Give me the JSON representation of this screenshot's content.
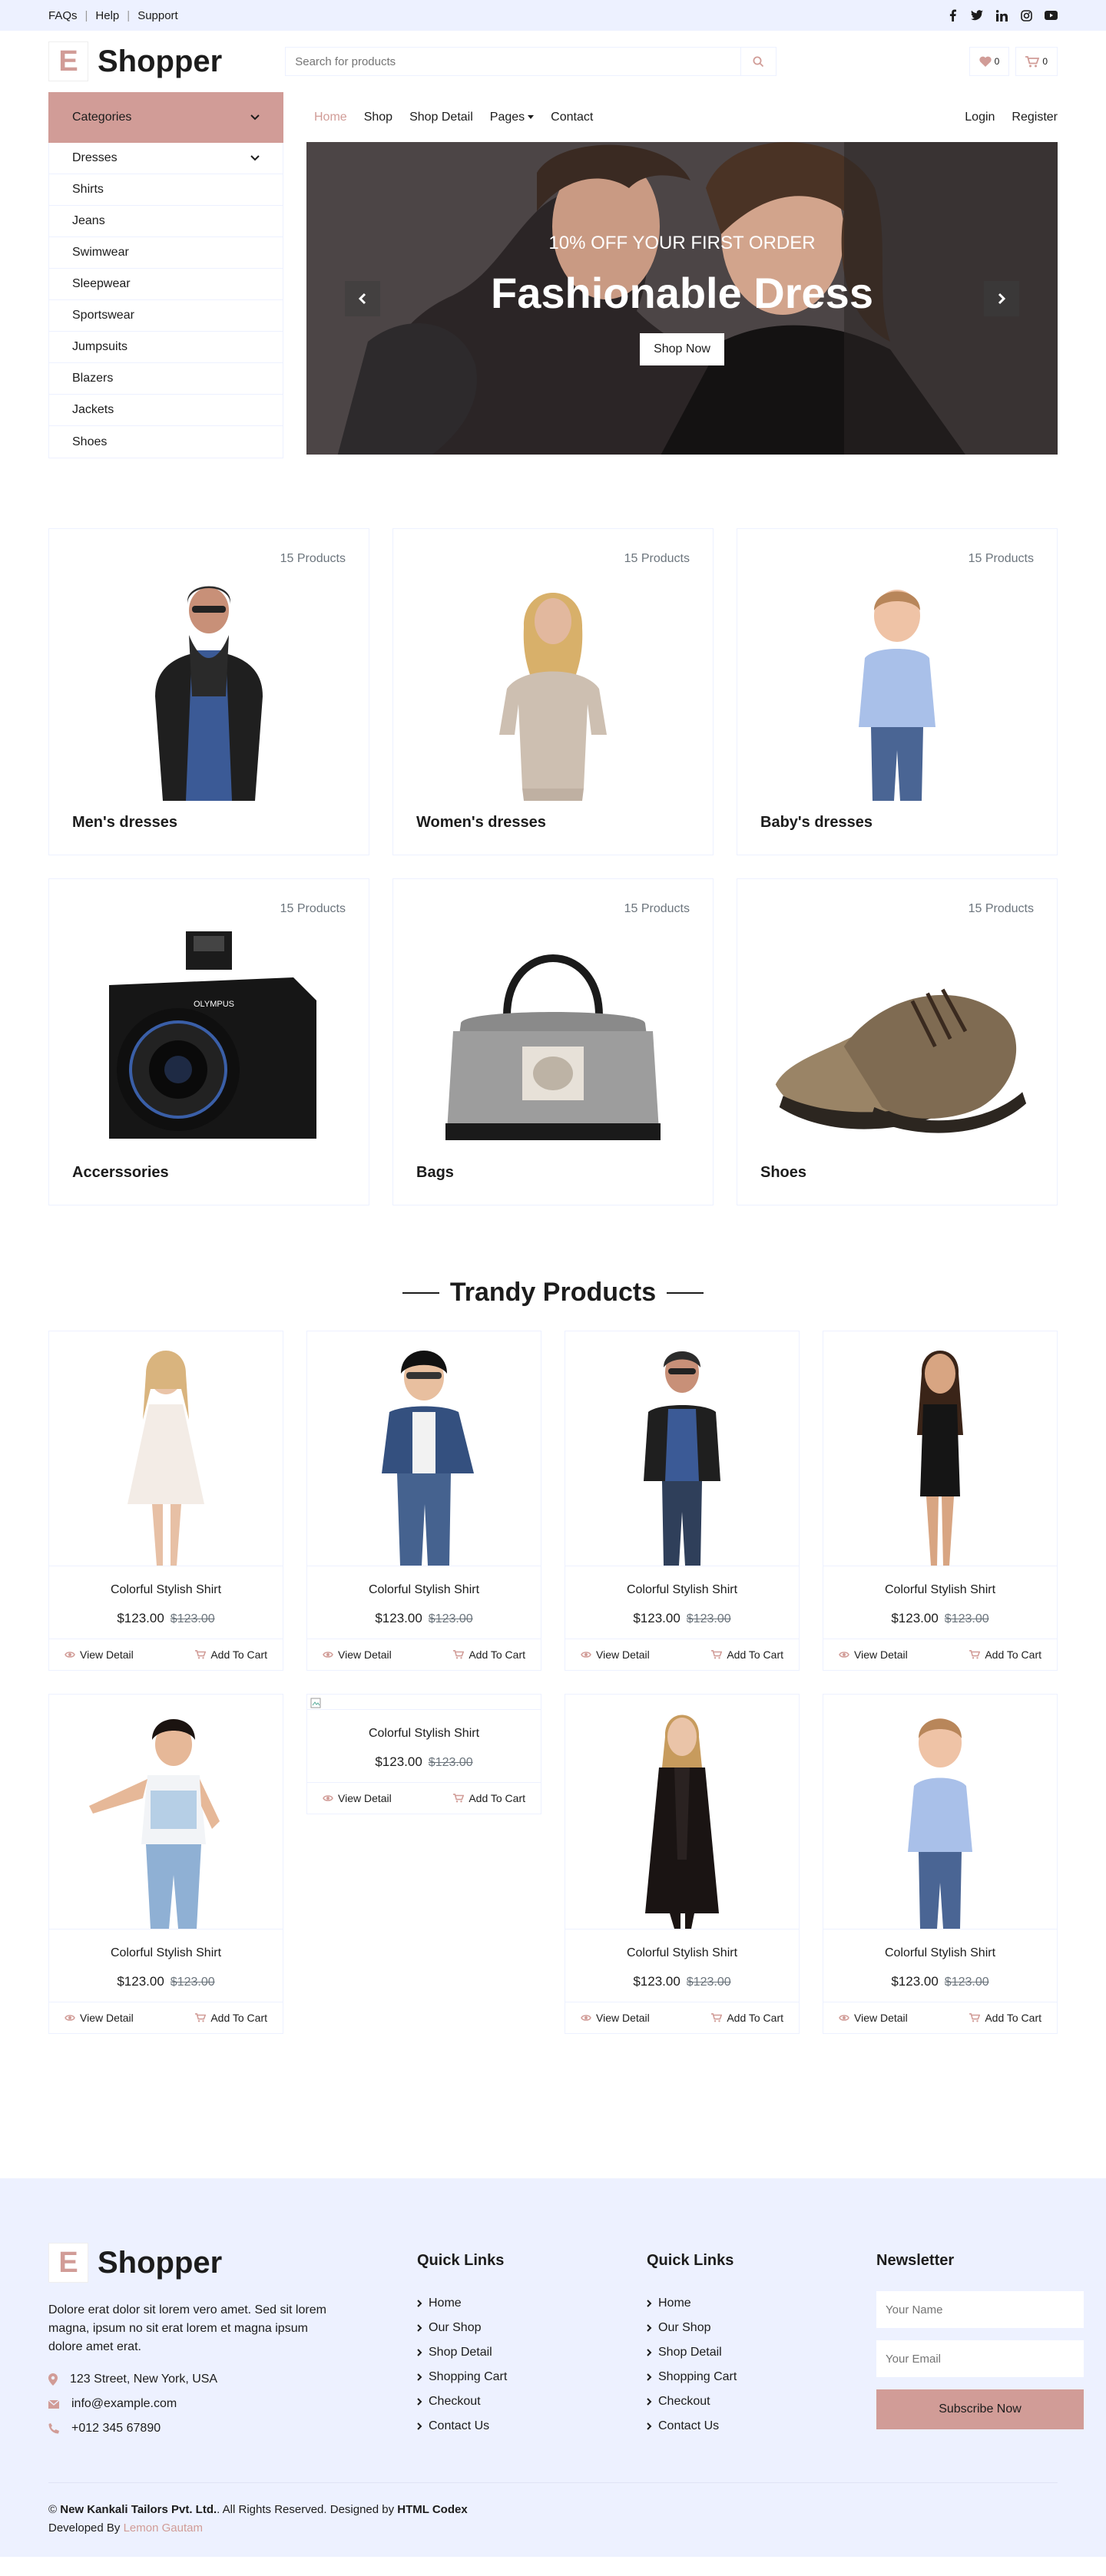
{
  "topbar": {
    "links": [
      "FAQs",
      "Help",
      "Support"
    ],
    "social": [
      "facebook-icon",
      "twitter-icon",
      "linkedin-icon",
      "instagram-icon",
      "youtube-icon"
    ]
  },
  "header": {
    "logo_letter": "E",
    "logo_text": "Shopper",
    "search_placeholder": "Search for products",
    "wishlist_count": "0",
    "cart_count": "0"
  },
  "colors": {
    "accent": "#d19c97",
    "light": "#edf1ff",
    "text": "#1c1c1c"
  },
  "categories": {
    "button": "Categories",
    "items": [
      "Dresses",
      "Shirts",
      "Jeans",
      "Swimwear",
      "Sleepwear",
      "Sportswear",
      "Jumpsuits",
      "Blazers",
      "Jackets",
      "Shoes"
    ]
  },
  "nav": {
    "items": [
      "Home",
      "Shop",
      "Shop Detail",
      "Pages",
      "Contact"
    ],
    "auth": [
      "Login",
      "Register"
    ]
  },
  "carousel": {
    "subtitle": "10% OFF YOUR FIRST ORDER",
    "title": "Fashionable Dress",
    "button": "Shop Now"
  },
  "cat_cards": [
    {
      "count": "15 Products",
      "name": "Men's dresses"
    },
    {
      "count": "15 Products",
      "name": "Women's dresses"
    },
    {
      "count": "15 Products",
      "name": "Baby's dresses"
    },
    {
      "count": "15 Products",
      "name": "Accerssories"
    },
    {
      "count": "15 Products",
      "name": "Bags"
    },
    {
      "count": "15 Products",
      "name": "Shoes"
    }
  ],
  "trendy": {
    "title": "Trandy Products",
    "view": "View Detail",
    "add": "Add To Cart",
    "products": [
      {
        "name": "Colorful Stylish Shirt",
        "price": "$123.00",
        "old": "$123.00"
      },
      {
        "name": "Colorful Stylish Shirt",
        "price": "$123.00",
        "old": "$123.00"
      },
      {
        "name": "Colorful Stylish Shirt",
        "price": "$123.00",
        "old": "$123.00"
      },
      {
        "name": "Colorful Stylish Shirt",
        "price": "$123.00",
        "old": "$123.00"
      },
      {
        "name": "Colorful Stylish Shirt",
        "price": "$123.00",
        "old": "$123.00"
      },
      {
        "name": "Colorful Stylish Shirt",
        "price": "$123.00",
        "old": "$123.00"
      },
      {
        "name": "Colorful Stylish Shirt",
        "price": "$123.00",
        "old": "$123.00"
      },
      {
        "name": "Colorful Stylish Shirt",
        "price": "$123.00",
        "old": "$123.00"
      }
    ]
  },
  "footer": {
    "desc": "Dolore erat dolor sit lorem vero amet. Sed sit lorem magna, ipsum no sit erat lorem et magna ipsum dolore amet erat.",
    "address": "123 Street, New York, USA",
    "email": "info@example.com",
    "phone": "+012 345 67890",
    "col2_title": "Quick Links",
    "col3_title": "Quick Links",
    "links": [
      "Home",
      "Our Shop",
      "Shop Detail",
      "Shopping Cart",
      "Checkout",
      "Contact Us"
    ],
    "newsletter_title": "Newsletter",
    "name_placeholder": "Your Name",
    "email_placeholder": "Your Email",
    "subscribe": "Subscribe Now",
    "copy_prefix": "©",
    "company": "New Kankali Tailors Pvt. Ltd.",
    "copy_mid": ". All Rights Reserved. Designed by",
    "designer": "HTML Codex",
    "dev_prefix": "Developed By",
    "developer": "Lemon Gautam"
  }
}
